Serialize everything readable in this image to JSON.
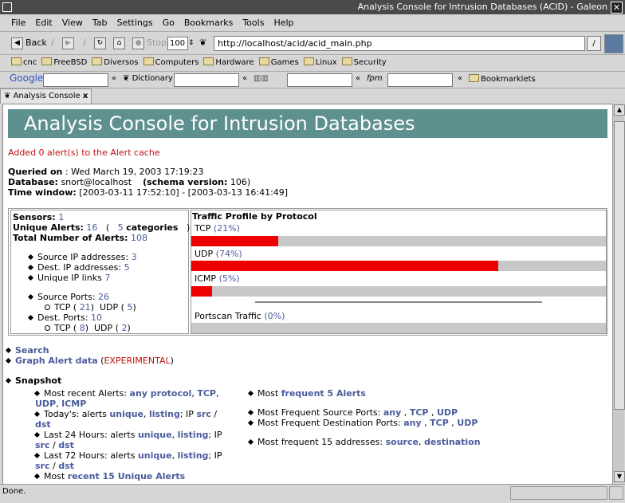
{
  "window": {
    "title": "Analysis Console for Intrusion Databases (ACID) - Galeon"
  },
  "menu": [
    "File",
    "Edit",
    "View",
    "Tab",
    "Settings",
    "Go",
    "Bookmarks",
    "Tools",
    "Help"
  ],
  "nav": {
    "back": "Back",
    "stop": "Stop",
    "zoom": "100",
    "url": "http://localhost/acid/acid_main.php"
  },
  "bookmarks": [
    "cnc",
    "FreeBSD",
    "Diversos",
    "Computers",
    "Hardware",
    "Games",
    "Linux",
    "Security"
  ],
  "searchbar": {
    "google": "Google",
    "dictionary": "Dictionary",
    "fpm": "fpm",
    "bookmarklets": "Bookmarklets"
  },
  "tab": {
    "label": "Analysis Console",
    "close": "x"
  },
  "status": {
    "text": "Done."
  },
  "page": {
    "banner": "Analysis Console for Intrusion Databases",
    "cache_msg": "Added 0 alert(s) to the Alert cache",
    "queried_label": "Queried on",
    "queried_value": " : Wed March 19, 2003 17:19:23",
    "database_label": "Database:",
    "database_value": " snort@localhost",
    "schema_label": "(schema version:",
    "schema_value": " 106)",
    "time_label": "Time window:",
    "time_value": " [2003-03-11 17:52:10] - [2003-03-13 16:41:49]",
    "sensors_label": "Sensors:",
    "sensors_value": "1",
    "unique_label": "Unique Alerts:",
    "unique_value": "16",
    "categories_value": "5",
    "categories_label": "categories",
    "total_label": "Total Number of Alerts:",
    "total_value": "108",
    "src_ip_label": "Source IP addresses:",
    "src_ip_value": "3",
    "dst_ip_label": "Dest. IP addresses:",
    "dst_ip_value": "5",
    "ip_links_label": "Unique IP links",
    "ip_links_value": "7",
    "src_ports_label": "Source Ports:",
    "src_ports_value": "26",
    "src_tcp": "21",
    "src_udp": "5",
    "dst_ports_label": "Dest. Ports:",
    "dst_ports_value": "10",
    "dst_tcp": "8",
    "dst_udp": "2",
    "tcp_word": "TCP",
    "udp_word": "UDP",
    "traffic_title": "Traffic Profile by Protocol",
    "protocols": [
      {
        "name": "TCP",
        "pct_label": "(21%)",
        "pct": 21
      },
      {
        "name": "UDP",
        "pct_label": "(74%)",
        "pct": 74
      },
      {
        "name": "ICMP",
        "pct_label": "(5%)",
        "pct": 5
      }
    ],
    "portscan_label": "Portscan Traffic",
    "portscan_pct_label": "(0%)",
    "portscan_pct": 0,
    "search_link": "Search",
    "graph_link": "Graph Alert data",
    "experimental": "EXPERIMENTAL",
    "snapshot_title": "Snapshot",
    "recent_alerts_label": "Most recent Alerts:",
    "link_any_protocol": "any protocol",
    "link_tcp": "TCP",
    "link_udp": "UDP",
    "link_icmp": "ICMP",
    "today_label": "Today's: alerts",
    "last24_label": "Last 24 Hours: alerts",
    "last72_label": "Last 72 Hours: alerts",
    "link_unique": "unique",
    "link_listing": "listing",
    "ip_label": "IP",
    "link_src": "src",
    "link_dst": "dst",
    "most_recent15_label": "Most",
    "link_recent15": "recent 15 Unique Alerts",
    "most_label": "Most",
    "link_frequent5": "frequent 5 Alerts",
    "freq_src_label": "Most Frequent Source Ports:",
    "freq_dst_label": "Most Frequent Destination Ports:",
    "link_any": "any",
    "freq15_label": "Most frequent 15 addresses:",
    "link_source": "source",
    "link_destination": "destination"
  }
}
